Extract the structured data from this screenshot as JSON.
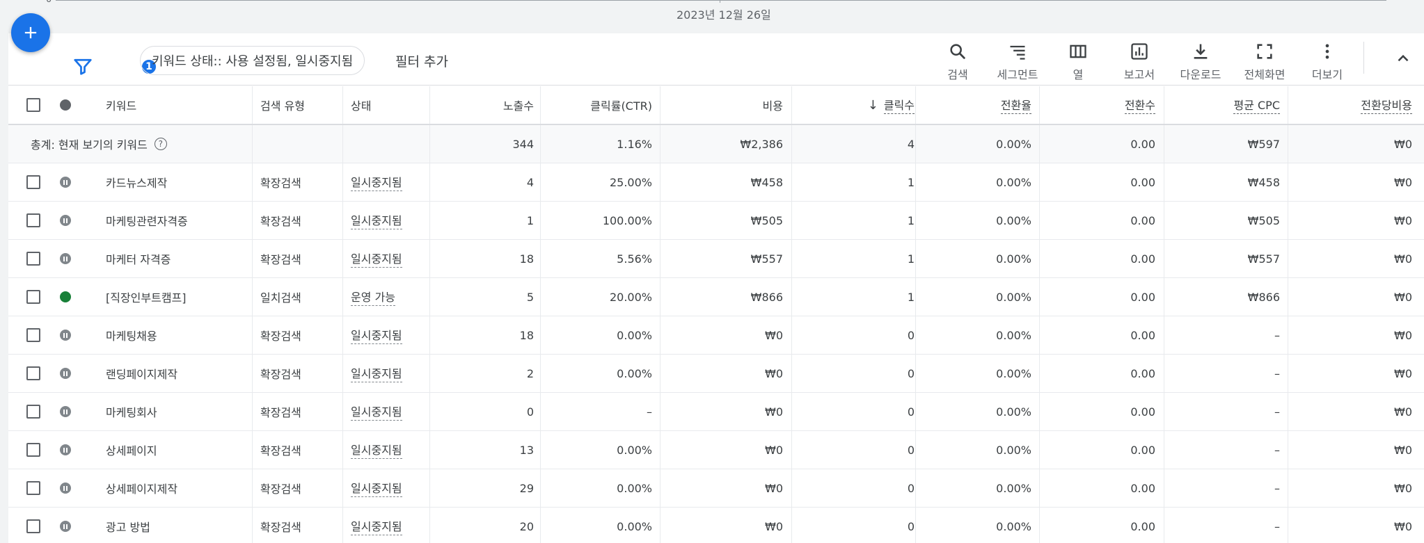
{
  "chart": {
    "axis_zero": "0",
    "date_label": "2023년 12월 26일"
  },
  "toolbar": {
    "filter_count": "1",
    "filter_chip": "키워드 상태:: 사용 설정됨, 일시중지됨",
    "add_filter": "필터 추가",
    "tools": [
      {
        "label": "검색",
        "icon": "search-icon"
      },
      {
        "label": "세그먼트",
        "icon": "segment-icon"
      },
      {
        "label": "열",
        "icon": "columns-icon"
      },
      {
        "label": "보고서",
        "icon": "reports-icon"
      },
      {
        "label": "다운로드",
        "icon": "download-icon"
      },
      {
        "label": "전체화면",
        "icon": "fullscreen-icon"
      },
      {
        "label": "더보기",
        "icon": "more-vert-icon"
      }
    ]
  },
  "table": {
    "headers": {
      "keyword": "키워드",
      "match_type": "검색 유형",
      "status": "상태",
      "impressions": "노출수",
      "ctr": "클릭률(CTR)",
      "cost": "비용",
      "clicks": "클릭수",
      "conv_rate": "전환율",
      "conversions": "전환수",
      "avg_cpc": "평균 CPC",
      "cost_per_conv": "전환당비용"
    },
    "total": {
      "label": "총계: 현재 보기의 키워드",
      "impressions": "344",
      "ctr": "1.16%",
      "cost": "₩2,386",
      "clicks": "4",
      "conv_rate": "0.00%",
      "conversions": "0.00",
      "avg_cpc": "₩597",
      "cost_per_conv": "₩0"
    },
    "rows": [
      {
        "keyword": "카드뉴스제작",
        "match_type": "확장검색",
        "status": "일시중지됨",
        "state": "paused",
        "impressions": "4",
        "ctr": "25.00%",
        "cost": "₩458",
        "clicks": "1",
        "conv_rate": "0.00%",
        "conversions": "0.00",
        "avg_cpc": "₩458",
        "cost_per_conv": "₩0"
      },
      {
        "keyword": "마케팅관련자격증",
        "match_type": "확장검색",
        "status": "일시중지됨",
        "state": "paused",
        "impressions": "1",
        "ctr": "100.00%",
        "cost": "₩505",
        "clicks": "1",
        "conv_rate": "0.00%",
        "conversions": "0.00",
        "avg_cpc": "₩505",
        "cost_per_conv": "₩0"
      },
      {
        "keyword": "마케터 자격증",
        "match_type": "확장검색",
        "status": "일시중지됨",
        "state": "paused",
        "impressions": "18",
        "ctr": "5.56%",
        "cost": "₩557",
        "clicks": "1",
        "conv_rate": "0.00%",
        "conversions": "0.00",
        "avg_cpc": "₩557",
        "cost_per_conv": "₩0"
      },
      {
        "keyword": "[직장인부트캠프]",
        "match_type": "일치검색",
        "status": "운영 가능",
        "state": "enabled",
        "impressions": "5",
        "ctr": "20.00%",
        "cost": "₩866",
        "clicks": "1",
        "conv_rate": "0.00%",
        "conversions": "0.00",
        "avg_cpc": "₩866",
        "cost_per_conv": "₩0"
      },
      {
        "keyword": "마케팅채용",
        "match_type": "확장검색",
        "status": "일시중지됨",
        "state": "paused",
        "impressions": "18",
        "ctr": "0.00%",
        "cost": "₩0",
        "clicks": "0",
        "conv_rate": "0.00%",
        "conversions": "0.00",
        "avg_cpc": "–",
        "cost_per_conv": "₩0"
      },
      {
        "keyword": "랜딩페이지제작",
        "match_type": "확장검색",
        "status": "일시중지됨",
        "state": "paused",
        "impressions": "2",
        "ctr": "0.00%",
        "cost": "₩0",
        "clicks": "0",
        "conv_rate": "0.00%",
        "conversions": "0.00",
        "avg_cpc": "–",
        "cost_per_conv": "₩0"
      },
      {
        "keyword": "마케팅회사",
        "match_type": "확장검색",
        "status": "일시중지됨",
        "state": "paused",
        "impressions": "0",
        "ctr": "–",
        "cost": "₩0",
        "clicks": "0",
        "conv_rate": "0.00%",
        "conversions": "0.00",
        "avg_cpc": "–",
        "cost_per_conv": "₩0"
      },
      {
        "keyword": "상세페이지",
        "match_type": "확장검색",
        "status": "일시중지됨",
        "state": "paused",
        "impressions": "13",
        "ctr": "0.00%",
        "cost": "₩0",
        "clicks": "0",
        "conv_rate": "0.00%",
        "conversions": "0.00",
        "avg_cpc": "–",
        "cost_per_conv": "₩0"
      },
      {
        "keyword": "상세페이지제작",
        "match_type": "확장검색",
        "status": "일시중지됨",
        "state": "paused",
        "impressions": "29",
        "ctr": "0.00%",
        "cost": "₩0",
        "clicks": "0",
        "conv_rate": "0.00%",
        "conversions": "0.00",
        "avg_cpc": "–",
        "cost_per_conv": "₩0"
      },
      {
        "keyword": "광고 방법",
        "match_type": "확장검색",
        "status": "일시중지됨",
        "state": "paused",
        "impressions": "20",
        "ctr": "0.00%",
        "cost": "₩0",
        "clicks": "0",
        "conv_rate": "0.00%",
        "conversions": "0.00",
        "avg_cpc": "–",
        "cost_per_conv": "₩0"
      }
    ]
  }
}
